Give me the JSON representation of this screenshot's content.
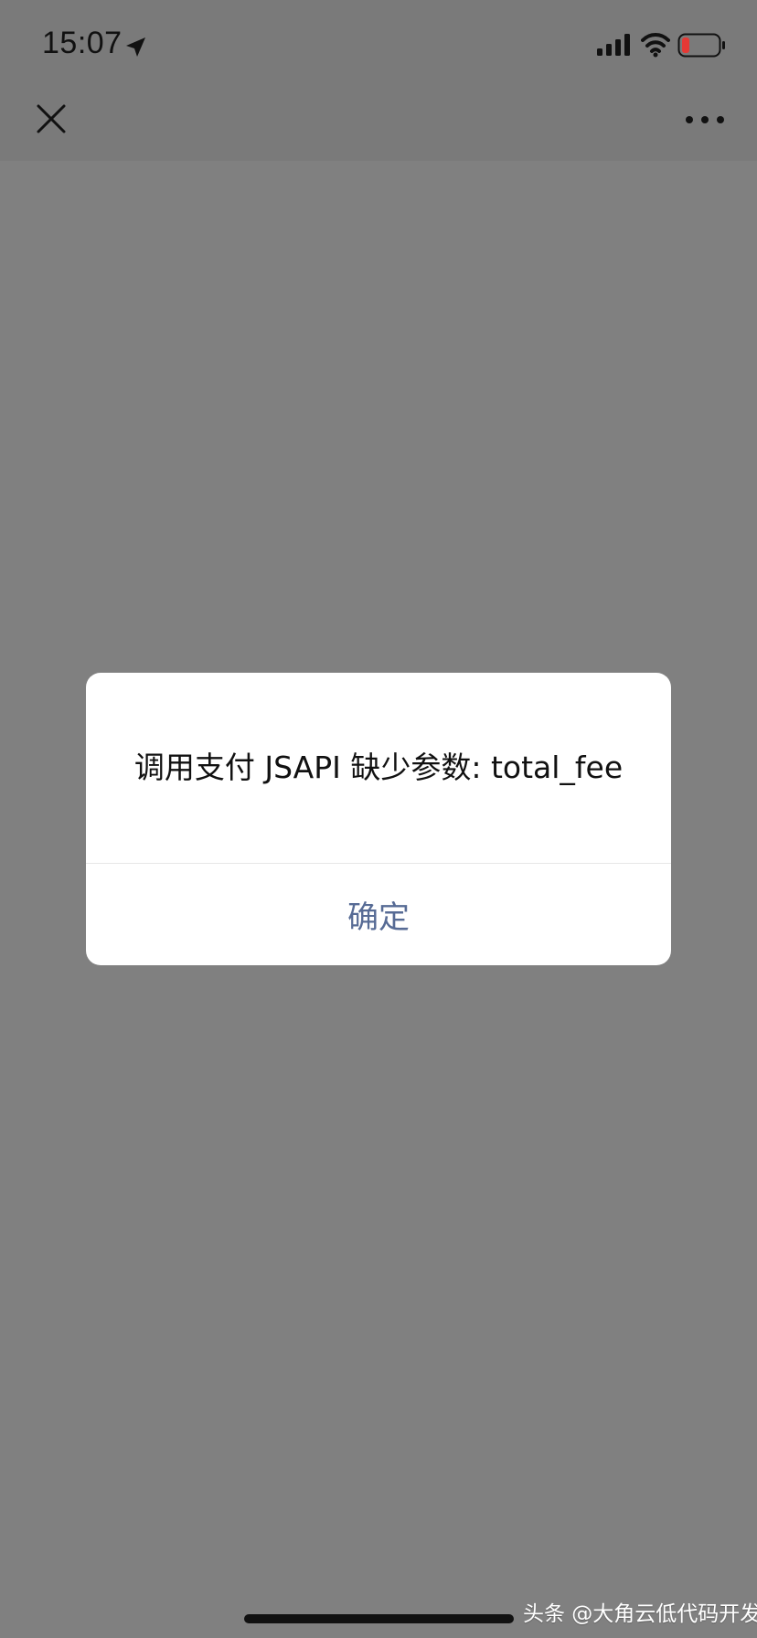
{
  "status_bar": {
    "time": "15:07",
    "icons": {
      "location": "location-arrow-icon",
      "signal": "cellular-signal-icon",
      "wifi": "wifi-icon",
      "battery": "battery-low-icon"
    }
  },
  "navigation": {
    "close_icon": "close-icon",
    "more_icon": "more-icon"
  },
  "dialog": {
    "message": "调用支付 JSAPI 缺少参数: total_fee",
    "confirm_label": "确定"
  },
  "watermark": {
    "text": "头条 @大角云低代码开发"
  },
  "colors": {
    "overlay": "#808080",
    "dialog_background": "#ffffff",
    "dialog_text": "#111111",
    "confirm_text": "#576b95",
    "battery_low": "#e53935"
  }
}
